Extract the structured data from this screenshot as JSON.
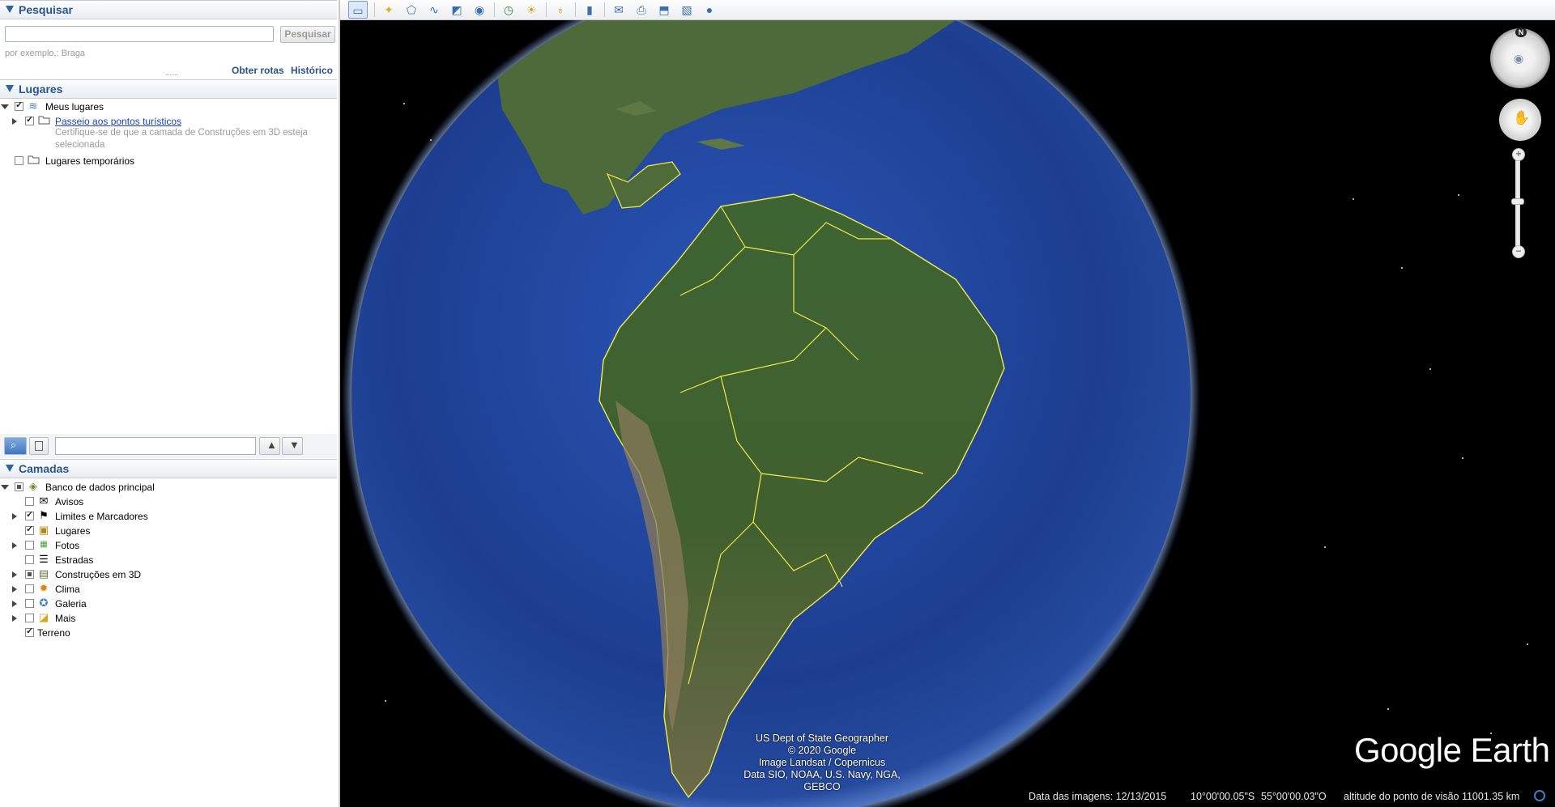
{
  "search": {
    "header": "Pesquisar",
    "input_value": "",
    "button": "Pesquisar",
    "hint": "por exemplo,: Braga",
    "directions": "Obter rotas",
    "history": "Histórico"
  },
  "places": {
    "header": "Lugares",
    "my_places": "Meus lugares",
    "tour": "Passeio aos pontos turísticos",
    "note": "Certifique-se de que a camada de Construções em 3D esteja selecionada",
    "temp": "Lugares temporários"
  },
  "layers": {
    "header": "Camadas",
    "items": [
      {
        "label": "Banco de dados principal",
        "state": "partial",
        "icon": "database-icon"
      },
      {
        "label": "Avisos",
        "state": "unchecked",
        "icon": "mail-icon"
      },
      {
        "label": "Limites e Marcadores",
        "state": "checked",
        "icon": "flag-icon"
      },
      {
        "label": "Lugares",
        "state": "checked",
        "icon": "place-icon"
      },
      {
        "label": "Fotos",
        "state": "unchecked",
        "icon": "photo-icon"
      },
      {
        "label": "Estradas",
        "state": "unchecked",
        "icon": "road-icon"
      },
      {
        "label": "Construções em 3D",
        "state": "partial",
        "icon": "building-icon"
      },
      {
        "label": "Clima",
        "state": "unchecked",
        "icon": "sun-icon"
      },
      {
        "label": "Galeria",
        "state": "unchecked",
        "icon": "star-icon"
      },
      {
        "label": "Mais",
        "state": "unchecked",
        "icon": "more-icon"
      },
      {
        "label": "Terreno",
        "state": "checked",
        "icon": ""
      }
    ]
  },
  "map": {
    "credits": [
      "US Dept of State Geographer",
      "© 2020 Google",
      "Image Landsat / Copernicus",
      "Data SIO, NOAA, U.S. Navy, NGA, GEBCO"
    ],
    "logo": "Google Earth",
    "compass_north": "N",
    "imagery_date": "Data das imagens: 12/13/2015",
    "lat": "10°00'00.05\"S",
    "lon": "55°00'00.03\"O",
    "altitude": "altitude do ponto de visão 11001.35 km"
  },
  "colors": {
    "ocean": "#1f3f8f",
    "land": "#355a2e",
    "border": "#f2e94a",
    "header_text": "#27568f"
  }
}
